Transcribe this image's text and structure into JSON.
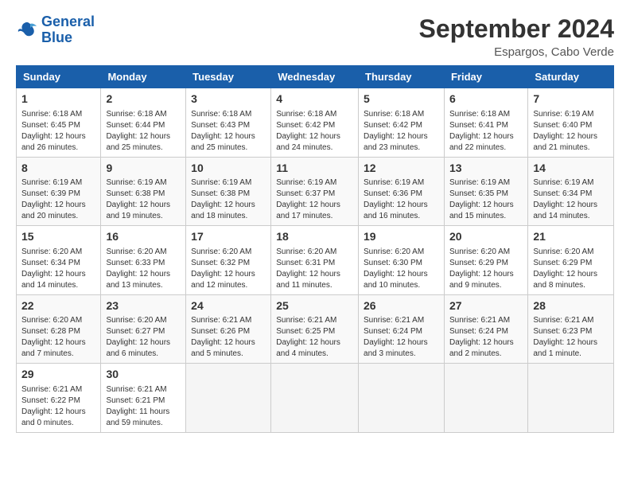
{
  "header": {
    "logo_line1": "General",
    "logo_line2": "Blue",
    "month": "September 2024",
    "location": "Espargos, Cabo Verde"
  },
  "days_of_week": [
    "Sunday",
    "Monday",
    "Tuesday",
    "Wednesday",
    "Thursday",
    "Friday",
    "Saturday"
  ],
  "weeks": [
    [
      {
        "day": "1",
        "info": "Sunrise: 6:18 AM\nSunset: 6:45 PM\nDaylight: 12 hours\nand 26 minutes."
      },
      {
        "day": "2",
        "info": "Sunrise: 6:18 AM\nSunset: 6:44 PM\nDaylight: 12 hours\nand 25 minutes."
      },
      {
        "day": "3",
        "info": "Sunrise: 6:18 AM\nSunset: 6:43 PM\nDaylight: 12 hours\nand 25 minutes."
      },
      {
        "day": "4",
        "info": "Sunrise: 6:18 AM\nSunset: 6:42 PM\nDaylight: 12 hours\nand 24 minutes."
      },
      {
        "day": "5",
        "info": "Sunrise: 6:18 AM\nSunset: 6:42 PM\nDaylight: 12 hours\nand 23 minutes."
      },
      {
        "day": "6",
        "info": "Sunrise: 6:18 AM\nSunset: 6:41 PM\nDaylight: 12 hours\nand 22 minutes."
      },
      {
        "day": "7",
        "info": "Sunrise: 6:19 AM\nSunset: 6:40 PM\nDaylight: 12 hours\nand 21 minutes."
      }
    ],
    [
      {
        "day": "8",
        "info": "Sunrise: 6:19 AM\nSunset: 6:39 PM\nDaylight: 12 hours\nand 20 minutes."
      },
      {
        "day": "9",
        "info": "Sunrise: 6:19 AM\nSunset: 6:38 PM\nDaylight: 12 hours\nand 19 minutes."
      },
      {
        "day": "10",
        "info": "Sunrise: 6:19 AM\nSunset: 6:38 PM\nDaylight: 12 hours\nand 18 minutes."
      },
      {
        "day": "11",
        "info": "Sunrise: 6:19 AM\nSunset: 6:37 PM\nDaylight: 12 hours\nand 17 minutes."
      },
      {
        "day": "12",
        "info": "Sunrise: 6:19 AM\nSunset: 6:36 PM\nDaylight: 12 hours\nand 16 minutes."
      },
      {
        "day": "13",
        "info": "Sunrise: 6:19 AM\nSunset: 6:35 PM\nDaylight: 12 hours\nand 15 minutes."
      },
      {
        "day": "14",
        "info": "Sunrise: 6:19 AM\nSunset: 6:34 PM\nDaylight: 12 hours\nand 14 minutes."
      }
    ],
    [
      {
        "day": "15",
        "info": "Sunrise: 6:20 AM\nSunset: 6:34 PM\nDaylight: 12 hours\nand 14 minutes."
      },
      {
        "day": "16",
        "info": "Sunrise: 6:20 AM\nSunset: 6:33 PM\nDaylight: 12 hours\nand 13 minutes."
      },
      {
        "day": "17",
        "info": "Sunrise: 6:20 AM\nSunset: 6:32 PM\nDaylight: 12 hours\nand 12 minutes."
      },
      {
        "day": "18",
        "info": "Sunrise: 6:20 AM\nSunset: 6:31 PM\nDaylight: 12 hours\nand 11 minutes."
      },
      {
        "day": "19",
        "info": "Sunrise: 6:20 AM\nSunset: 6:30 PM\nDaylight: 12 hours\nand 10 minutes."
      },
      {
        "day": "20",
        "info": "Sunrise: 6:20 AM\nSunset: 6:29 PM\nDaylight: 12 hours\nand 9 minutes."
      },
      {
        "day": "21",
        "info": "Sunrise: 6:20 AM\nSunset: 6:29 PM\nDaylight: 12 hours\nand 8 minutes."
      }
    ],
    [
      {
        "day": "22",
        "info": "Sunrise: 6:20 AM\nSunset: 6:28 PM\nDaylight: 12 hours\nand 7 minutes."
      },
      {
        "day": "23",
        "info": "Sunrise: 6:20 AM\nSunset: 6:27 PM\nDaylight: 12 hours\nand 6 minutes."
      },
      {
        "day": "24",
        "info": "Sunrise: 6:21 AM\nSunset: 6:26 PM\nDaylight: 12 hours\nand 5 minutes."
      },
      {
        "day": "25",
        "info": "Sunrise: 6:21 AM\nSunset: 6:25 PM\nDaylight: 12 hours\nand 4 minutes."
      },
      {
        "day": "26",
        "info": "Sunrise: 6:21 AM\nSunset: 6:24 PM\nDaylight: 12 hours\nand 3 minutes."
      },
      {
        "day": "27",
        "info": "Sunrise: 6:21 AM\nSunset: 6:24 PM\nDaylight: 12 hours\nand 2 minutes."
      },
      {
        "day": "28",
        "info": "Sunrise: 6:21 AM\nSunset: 6:23 PM\nDaylight: 12 hours\nand 1 minute."
      }
    ],
    [
      {
        "day": "29",
        "info": "Sunrise: 6:21 AM\nSunset: 6:22 PM\nDaylight: 12 hours\nand 0 minutes."
      },
      {
        "day": "30",
        "info": "Sunrise: 6:21 AM\nSunset: 6:21 PM\nDaylight: 11 hours\nand 59 minutes."
      },
      {
        "day": "",
        "info": ""
      },
      {
        "day": "",
        "info": ""
      },
      {
        "day": "",
        "info": ""
      },
      {
        "day": "",
        "info": ""
      },
      {
        "day": "",
        "info": ""
      }
    ]
  ]
}
